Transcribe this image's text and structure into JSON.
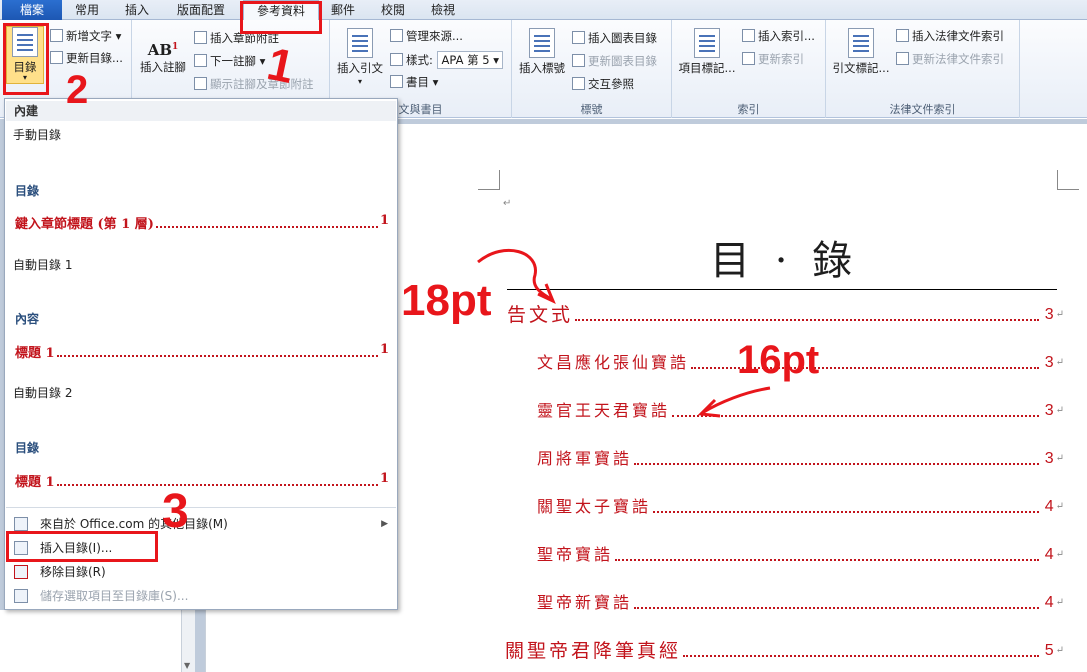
{
  "tabs": [
    "檔案",
    "常用",
    "插入",
    "版面配置",
    "參考資料",
    "郵件",
    "校閱",
    "檢視"
  ],
  "ribbon": {
    "toc_group": {
      "big": "目錄",
      "items": [
        "新增文字",
        "更新目錄..."
      ]
    },
    "footnotes_group": {
      "big": "插入註腳",
      "items": [
        "插入章節附註",
        "下一註腳",
        "顯示註腳及章節附註"
      ]
    },
    "citations_group": {
      "big": "插入引文",
      "items": [
        "管理來源...",
        "樣式:",
        "書目"
      ],
      "style_value": "APA 第 5",
      "label": "文與書目"
    },
    "captions_group": {
      "big": "插入標號",
      "items": [
        "插入圖表目錄",
        "更新圖表目錄",
        "交互參照"
      ],
      "label": "標號"
    },
    "index_group": {
      "big": "項目標記...",
      "items": [
        "插入索引...",
        "更新索引"
      ],
      "label": "索引"
    },
    "authorities_group": {
      "big": "引文標記...",
      "items": [
        "插入法律文件索引",
        "更新法律文件索引"
      ],
      "label": "法律文件索引"
    }
  },
  "dropdown": {
    "builtin_header": "內建",
    "manual_toc": "手動目錄",
    "gallery1_heading": "目錄",
    "gallery1_entry": "鍵入章節標題 (第 1 層)",
    "gallery1_page": "1",
    "auto1": "自動目錄 1",
    "gallery2_heading": "內容",
    "gallery2_entry": "標題 1",
    "gallery2_page": "1",
    "auto2": "自動目錄 2",
    "gallery3_heading": "目錄",
    "gallery3_entry": "標題 1",
    "gallery3_page": "1",
    "menu": [
      "來自於 Office.com 的其他目錄(M)",
      "插入目錄(I)...",
      "移除目錄(R)",
      "儲存選取項目至目錄庫(S)..."
    ]
  },
  "document": {
    "title": "目 · 錄",
    "entries": [
      {
        "text": "告文式",
        "page": "3"
      },
      {
        "text": "文昌應化張仙寶誥",
        "page": "3"
      },
      {
        "text": "靈官王天君寶誥",
        "page": "3"
      },
      {
        "text": "周將軍寶誥",
        "page": "3"
      },
      {
        "text": "關聖太子寶誥",
        "page": "4"
      },
      {
        "text": "聖帝寶誥",
        "page": "4"
      },
      {
        "text": "聖帝新寶誥",
        "page": "4"
      },
      {
        "text": "關聖帝君降筆真經",
        "page": "5"
      }
    ]
  },
  "annotations": {
    "step1": "1",
    "step2": "2",
    "step3": "3",
    "size_level1": "18pt",
    "size_level2": "16pt"
  },
  "colors": {
    "annotation": "#e8161b",
    "toc_text": "#c2141c",
    "file_tab": "#1d57b3"
  }
}
